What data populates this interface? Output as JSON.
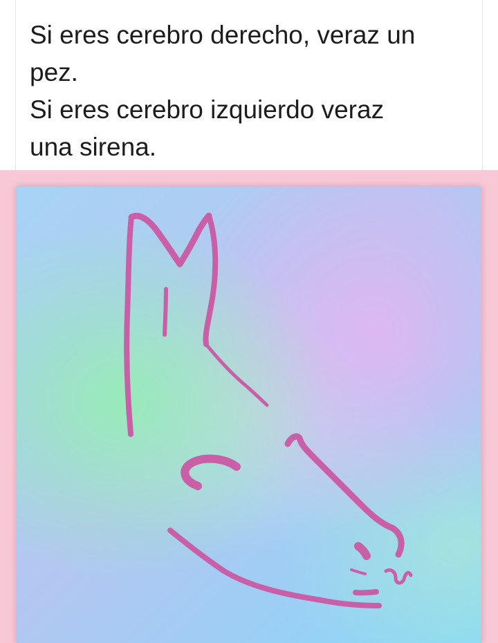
{
  "post": {
    "caption": "Si eres cerebro derecho, veraz un\npez.\nSi eres cerebro izquierdo veraz\nuna sirena."
  },
  "colors": {
    "line_art": "#c95fa6",
    "frame": "#f7c9d6",
    "card_background": "#ffffff"
  }
}
